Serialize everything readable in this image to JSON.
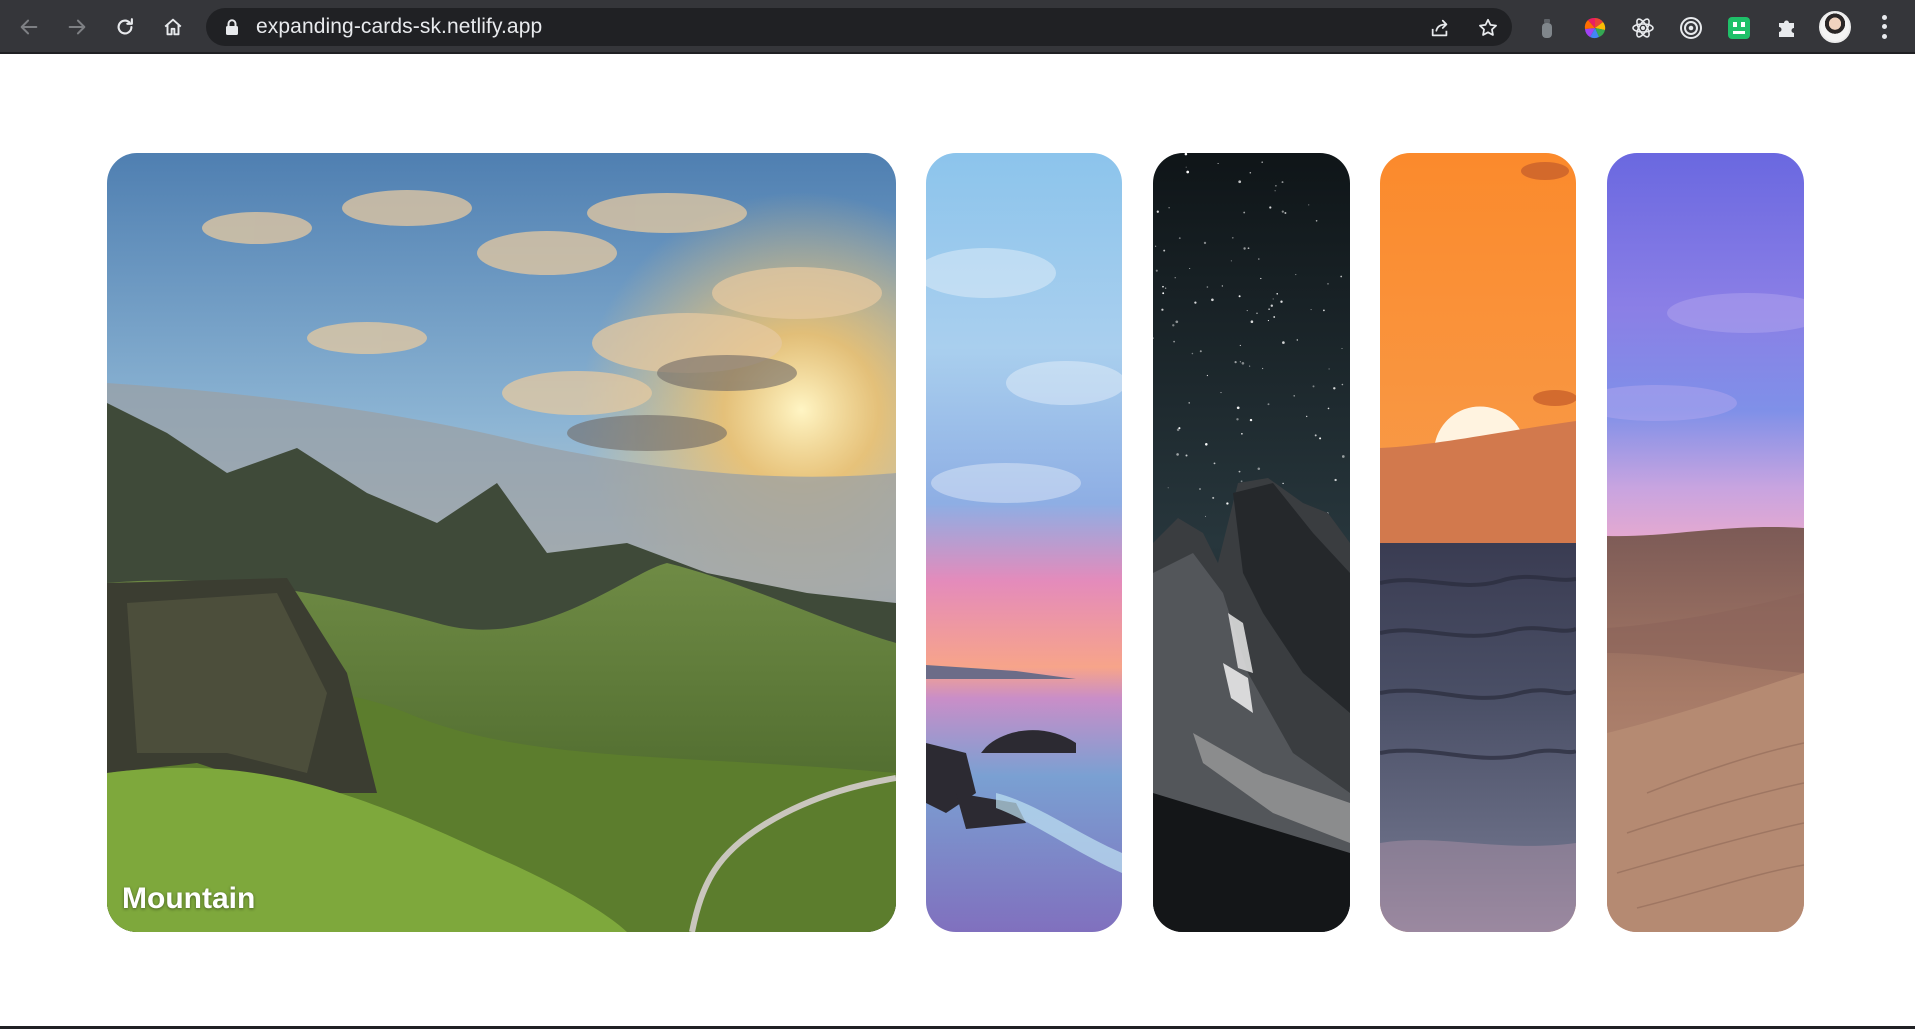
{
  "browser": {
    "url": "expanding-cards-sk.netlify.app",
    "address_bar_color": "#202124",
    "toolbar_color": "#35363a"
  },
  "cards": {
    "active_index": 0,
    "items": [
      {
        "label": "Mountain",
        "scene": "green mountain valley with road and sunset clouds"
      },
      {
        "label": "",
        "scene": "pink sunset ocean with rocks"
      },
      {
        "label": "",
        "scene": "night starry sky over dark mountain"
      },
      {
        "label": "",
        "scene": "orange sunset over ocean waves"
      },
      {
        "label": "",
        "scene": "purple sky over desert dunes"
      }
    ]
  }
}
